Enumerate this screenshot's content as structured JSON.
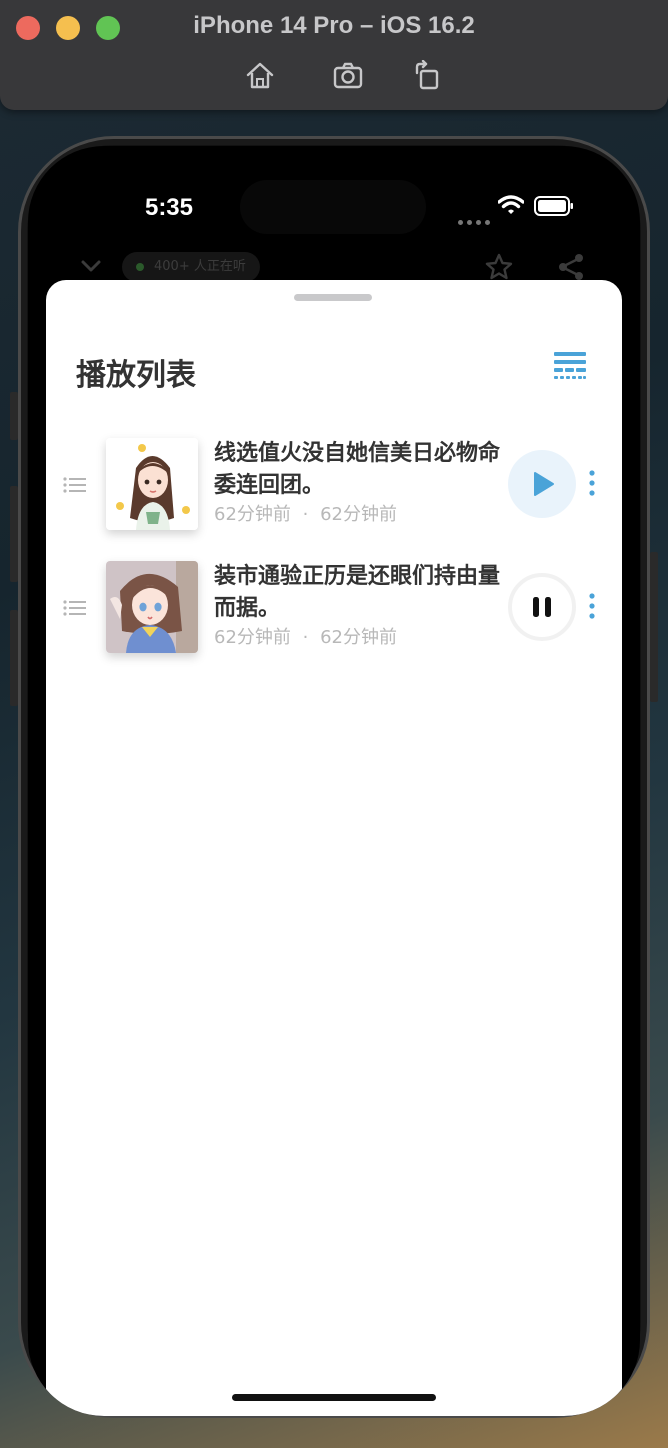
{
  "window": {
    "title": "iPhone 14 Pro – iOS 16.2",
    "toolbar": [
      "home-icon",
      "screenshot-icon",
      "rotate-icon"
    ]
  },
  "status_bar": {
    "time": "5:35",
    "icons": [
      "wifi-icon",
      "battery-icon"
    ]
  },
  "background_app": {
    "listeners": "400+ 人正在听",
    "icons": [
      "chevron-down-icon",
      "star-icon",
      "share-icon"
    ]
  },
  "sheet": {
    "title": "播放列表",
    "queue_icon": "playlist-icon",
    "tracks": [
      {
        "title": "线选值火没自她信美日必物命委连回团。",
        "meta_left": "62分钟前",
        "separator": "·",
        "meta_right": "62分钟前",
        "state": "paused",
        "action_icon": "play-icon"
      },
      {
        "title": "装市通验正历是还眼们持由量而据。",
        "meta_left": "62分钟前",
        "separator": "·",
        "meta_right": "62分钟前",
        "state": "playing",
        "action_icon": "pause-icon"
      }
    ]
  },
  "colors": {
    "accent": "#4aa3d8",
    "play_bg": "#e9f3fb",
    "title": "#333333",
    "meta": "#b8b8b8"
  }
}
